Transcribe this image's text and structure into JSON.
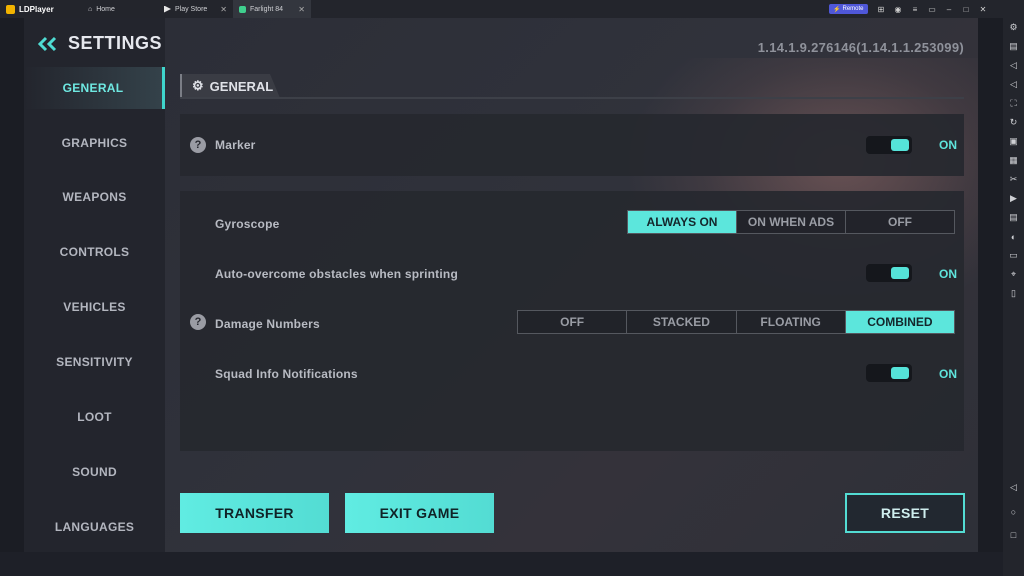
{
  "emulator": {
    "brand": "LDPlayer",
    "tabs": [
      {
        "label": "Home"
      },
      {
        "label": "Play Store"
      },
      {
        "label": "Farlight 84"
      }
    ],
    "remote_label": "Remote"
  },
  "settings": {
    "title": "SETTINGS",
    "version": "1.14.1.9.276146(1.14.1.1.253099)",
    "nav": [
      {
        "label": "GENERAL",
        "active": true
      },
      {
        "label": "GRAPHICS"
      },
      {
        "label": "WEAPONS"
      },
      {
        "label": "CONTROLS"
      },
      {
        "label": "VEHICLES"
      },
      {
        "label": "SENSITIVITY"
      },
      {
        "label": "LOOT"
      },
      {
        "label": "SOUND"
      },
      {
        "label": "LANGUAGES"
      }
    ],
    "section_title": "GENERAL",
    "marker": {
      "label": "Marker",
      "state": "ON"
    },
    "gyroscope": {
      "label": "Gyroscope",
      "options": [
        "ALWAYS ON",
        "ON WHEN ADS",
        "OFF"
      ],
      "selected": "ALWAYS ON"
    },
    "auto_overcome": {
      "label": "Auto-overcome obstacles when sprinting",
      "state": "ON"
    },
    "damage_numbers": {
      "label": "Damage Numbers",
      "options": [
        "OFF",
        "STACKED",
        "FLOATING",
        "COMBINED"
      ],
      "selected": "COMBINED"
    },
    "squad_info": {
      "label": "Squad Info Notifications",
      "state": "ON"
    },
    "buttons": {
      "transfer": "TRANSFER",
      "exit": "EXIT GAME",
      "reset": "RESET"
    }
  },
  "colors": {
    "accent": "#55e3d9",
    "panel": "#26282f",
    "nav_bg": "#23252d"
  }
}
